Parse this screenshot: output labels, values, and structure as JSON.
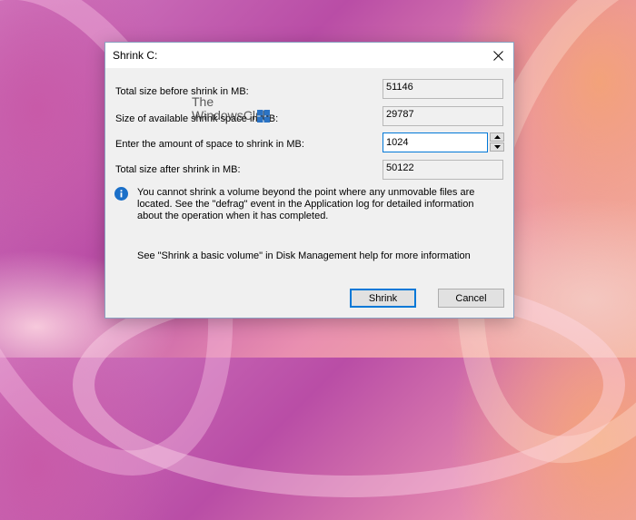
{
  "dialog": {
    "title": "Shrink C:",
    "rows": [
      {
        "label": "Total size before shrink in MB:",
        "value": "51146"
      },
      {
        "label": "Size of available shrink space in MB:",
        "value": "29787"
      },
      {
        "label": "Enter the amount of space to shrink in MB:",
        "value": "1024"
      },
      {
        "label": "Total size after shrink in MB:",
        "value": "50122"
      }
    ],
    "info_message": "You cannot shrink a volume beyond the point where any unmovable files are located. See the \"defrag\" event in the Application log for detailed information about the operation when it has completed.",
    "help_message": "See \"Shrink a basic volume\" in Disk Management help for more information",
    "buttons": {
      "shrink": "Shrink",
      "cancel": "Cancel"
    }
  },
  "watermark": {
    "line1": "The",
    "line2": "WindowsClub"
  },
  "icons": {
    "close": "close-icon",
    "info": "info-icon",
    "spin_up": "chevron-up-icon",
    "spin_down": "chevron-down-icon",
    "watermark_logo": "windowsclub-logo"
  },
  "colors": {
    "accent": "#0078d7",
    "info_icon": "#1a6fc8",
    "dialog_bg": "#f0f0f0"
  }
}
